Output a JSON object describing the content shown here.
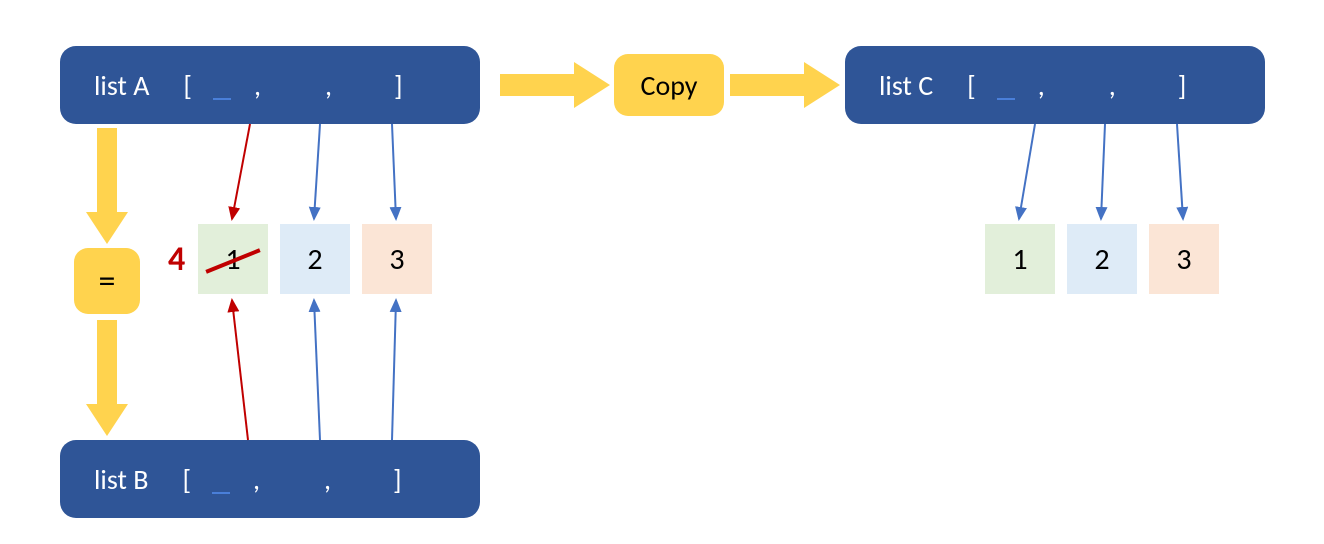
{
  "lists": {
    "a": {
      "label": "list A",
      "open": "[",
      "close": "]",
      "sep": ","
    },
    "b": {
      "label": "list B",
      "open": "[",
      "close": "]",
      "sep": ","
    },
    "c": {
      "label": "list C",
      "open": "[",
      "close": "]",
      "sep": ","
    }
  },
  "shared_cells": {
    "v1": "1",
    "v2": "2",
    "v3": "3",
    "new_v1": "4"
  },
  "copy_cells": {
    "v1": "1",
    "v2": "2",
    "v3": "3"
  },
  "ops": {
    "equals": "=",
    "copy": "Copy"
  }
}
